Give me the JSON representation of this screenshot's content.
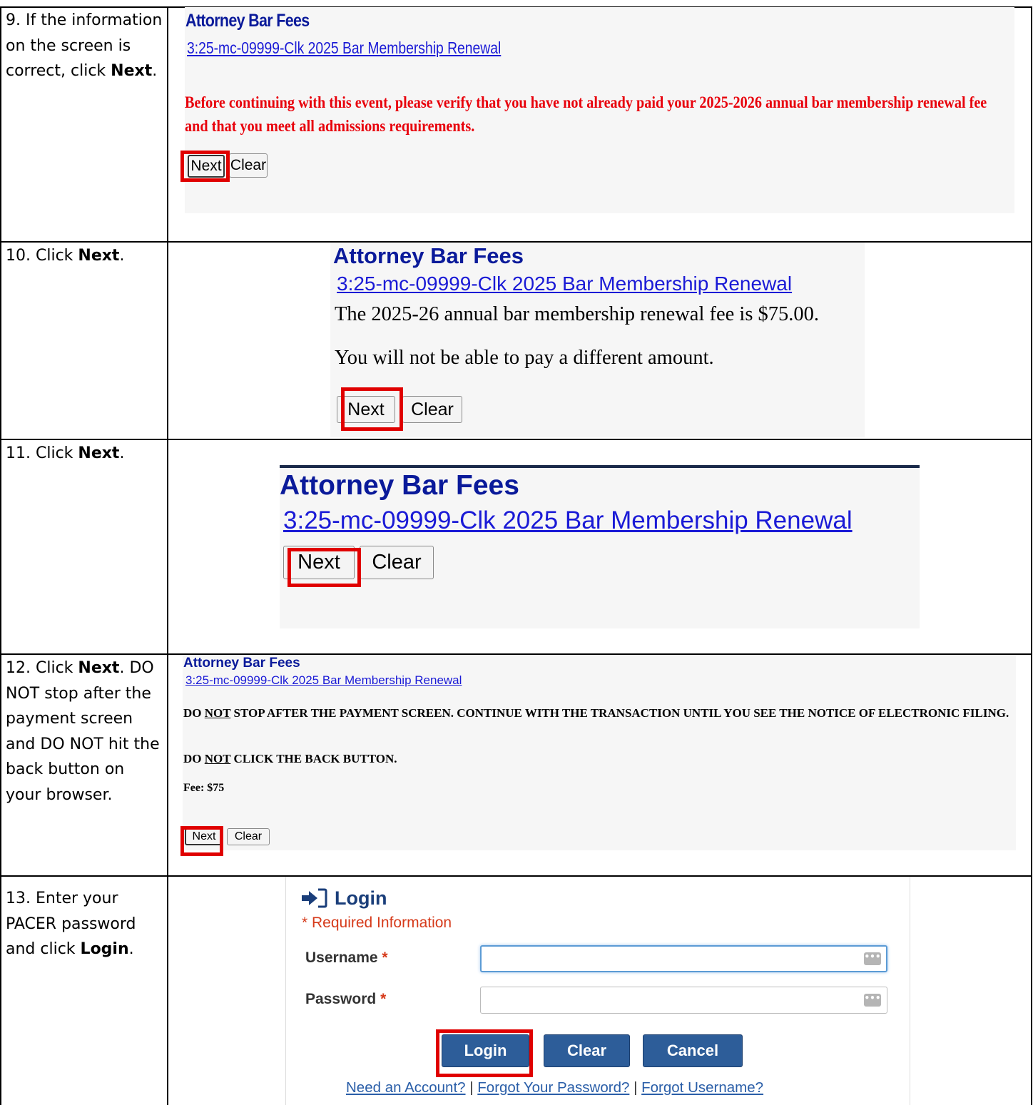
{
  "rows": [
    {
      "step_text_before": "9. If the information on the screen is correct, click ",
      "step_bold": "Next",
      "step_text_after": ".",
      "screen": {
        "title": "Attorney Bar Fees",
        "case_link": "3:25-mc-09999-Clk 2025 Bar Membership Renewal",
        "warning": "Before continuing with this event, please verify that you have not already paid your 2025-2026 annual bar membership renewal fee and that you meet all admissions requirements.",
        "next_label": "Next",
        "clear_label": "Clear"
      }
    },
    {
      "step_text_before": "10. Click ",
      "step_bold": "Next",
      "step_text_after": ".",
      "screen": {
        "title": "Attorney Bar Fees",
        "case_link": "3:25-mc-09999-Clk 2025 Bar Membership Renewal",
        "fee_line": "The 2025-26 annual bar membership renewal fee is $75.00.",
        "amount_line": "You will not be able to pay a different amount.",
        "next_label": "Next",
        "clear_label": "Clear"
      }
    },
    {
      "step_text_before": "11. Click ",
      "step_bold": "Next",
      "step_text_after": ".",
      "screen": {
        "title": "Attorney Bar Fees",
        "case_link": "3:25-mc-09999-Clk 2025 Bar Membership Renewal",
        "next_label": "Next",
        "clear_label": "Clear"
      }
    },
    {
      "step_text_before": "12. Click ",
      "step_bold": "Next",
      "step_text_after": ". DO NOT stop after the payment screen and DO NOT hit the back button on your browser.",
      "screen": {
        "title": "Attorney Bar Fees",
        "case_link": "3:25-mc-09999-Clk 2025 Bar Membership Renewal",
        "warn1_a": "DO ",
        "warn1_u": "NOT",
        "warn1_b": " STOP AFTER THE PAYMENT SCREEN. CONTINUE WITH THE TRANSACTION UNTIL YOU SEE THE NOTICE OF ELECTRONIC FILING.",
        "warn2_a": "DO ",
        "warn2_u": "NOT",
        "warn2_b": " CLICK THE BACK BUTTON.",
        "fee": "Fee: $75",
        "next_label": "Next",
        "clear_label": "Clear"
      }
    },
    {
      "step_text_before": "13. Enter your PACER password and click ",
      "step_bold": "Login",
      "step_text_after": ".",
      "screen": {
        "login_icon": "sign-in-icon",
        "title": "Login",
        "required_note": "* Required Information",
        "username_label": "Username",
        "password_label": "Password",
        "required_star": "*",
        "username_value": "",
        "password_value": "",
        "field_icon_glyph": "•••",
        "login_label": "Login",
        "clear_label": "Clear",
        "cancel_label": "Cancel",
        "need_account": "Need an Account?",
        "forgot_password": "Forgot Your Password?",
        "forgot_username": "Forgot Username?",
        "separator": "|"
      }
    }
  ],
  "colors": {
    "highlight": "#e00000",
    "title_blue": "#0a1a9a",
    "link_blue": "#1a1ad6",
    "warning_red": "#e8000b",
    "login_button": "#2d5d99",
    "panel_bg": "#f6f6f6"
  }
}
